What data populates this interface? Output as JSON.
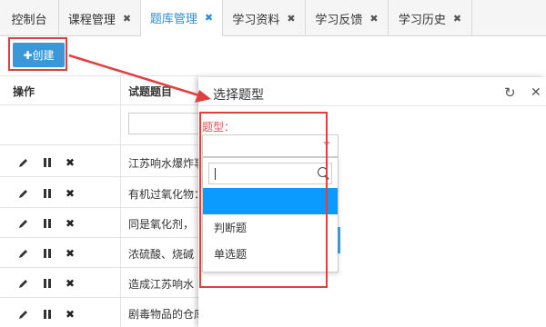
{
  "tabs": [
    {
      "label": "控制台",
      "closable": false,
      "active": false
    },
    {
      "label": "课程管理",
      "closable": true,
      "active": false
    },
    {
      "label": "题库管理",
      "closable": true,
      "active": true
    },
    {
      "label": "学习资料",
      "closable": true,
      "active": false
    },
    {
      "label": "学习反馈",
      "closable": true,
      "active": false
    },
    {
      "label": "学习历史",
      "closable": true,
      "active": false
    }
  ],
  "tab_close_glyph": "✖",
  "toolbar": {
    "create_label": "✚创建"
  },
  "table": {
    "headers": {
      "actions": "操作",
      "title": "试题题目"
    },
    "rows": [
      {
        "text": "江苏响水爆炸事故"
      },
      {
        "text": "有机过氧化物："
      },
      {
        "text": "同是氧化剂，"
      },
      {
        "text": "浓硫酸、烧碱"
      },
      {
        "text": "造成江苏响水"
      },
      {
        "text": "剧毒物品的仓库"
      }
    ]
  },
  "modal": {
    "title": "选择题型",
    "field_label": "题型：",
    "select_value": "",
    "search_value": "",
    "options": [
      {
        "label": "",
        "highlighted": true
      },
      {
        "label": "判断题",
        "highlighted": false
      },
      {
        "label": "单选题",
        "highlighted": false
      }
    ]
  },
  "colors": {
    "accent": "#2b8fd8",
    "button": "#3a98d8",
    "annotation": "#e23e3e",
    "highlight_option": "#0b9bff",
    "required_label": "#e05454"
  }
}
